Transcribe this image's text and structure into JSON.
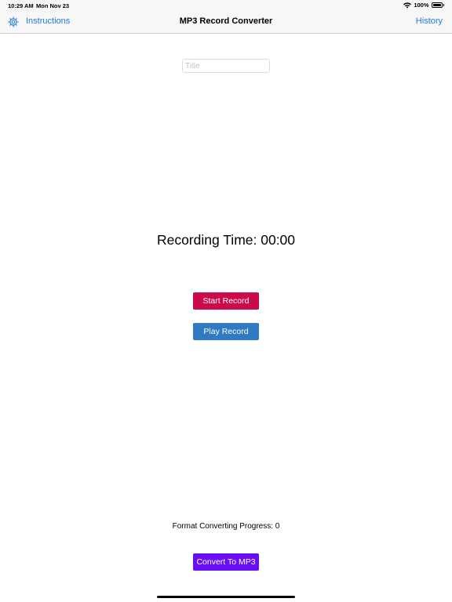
{
  "status_bar": {
    "time": "10:29 AM",
    "date": "Mon Nov 23",
    "battery": "100%",
    "wifi_icon": "wifi-icon",
    "battery_icon": "battery-icon"
  },
  "nav": {
    "settings_icon": "gear-icon",
    "instructions_label": "Instructions",
    "title": "MP3 Record Converter",
    "history_label": "History",
    "accent_color": "#1f7ae0"
  },
  "title_field": {
    "placeholder": "Title",
    "value": ""
  },
  "recording": {
    "time_text": "Recording Time: 00:00"
  },
  "buttons": {
    "start_record": "Start Record",
    "play_record": "Play Record",
    "convert": "Convert To MP3"
  },
  "progress": {
    "text": "Format Converting Progress: 0"
  },
  "colors": {
    "start_record": "#cc0a4a",
    "play_record": "#2e7bc4",
    "convert": "#6a0ff5"
  }
}
